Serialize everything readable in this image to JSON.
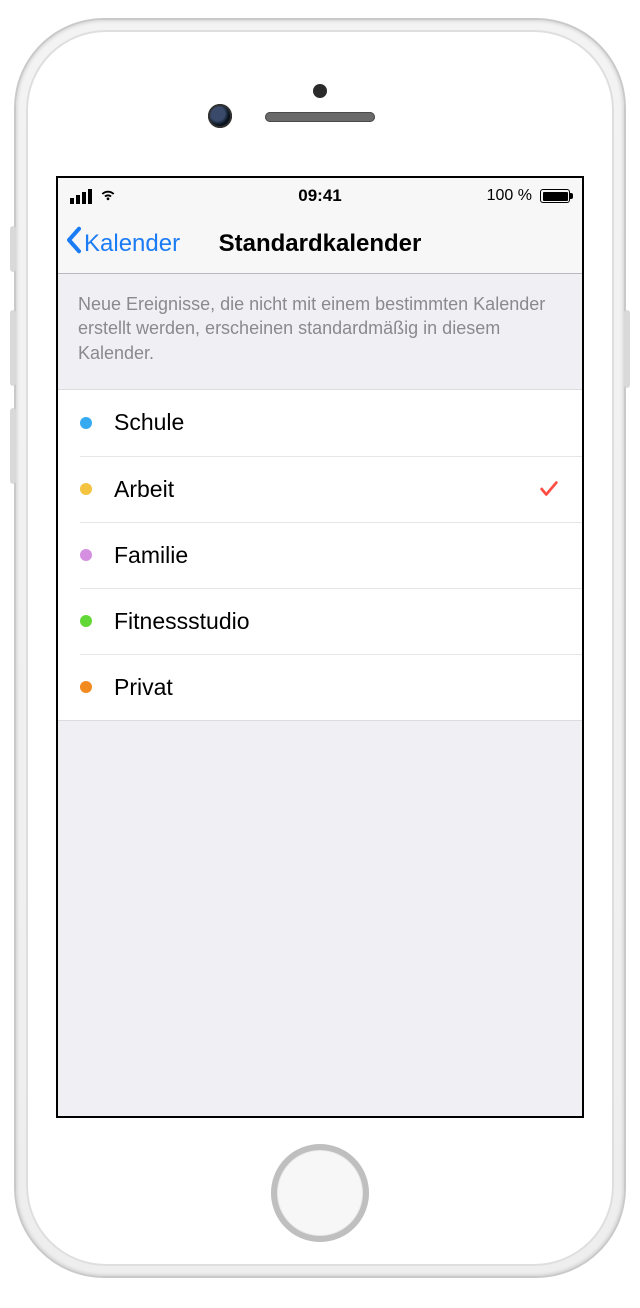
{
  "statusbar": {
    "time": "09:41",
    "battery_pct": "100 %"
  },
  "navbar": {
    "back_label": "Kalender",
    "title": "Standardkalender"
  },
  "description": "Neue Ereignisse, die nicht mit einem bestimmten Kalender erstellt werden, erscheinen standardmäßig in diesem Kalender.",
  "calendars": [
    {
      "label": "Schule",
      "color": "#36aaf0",
      "selected": false
    },
    {
      "label": "Arbeit",
      "color": "#f4c340",
      "selected": true
    },
    {
      "label": "Familie",
      "color": "#d48fe0",
      "selected": false
    },
    {
      "label": "Fitnessstudio",
      "color": "#62d837",
      "selected": false
    },
    {
      "label": "Privat",
      "color": "#f28a1f",
      "selected": false
    }
  ]
}
